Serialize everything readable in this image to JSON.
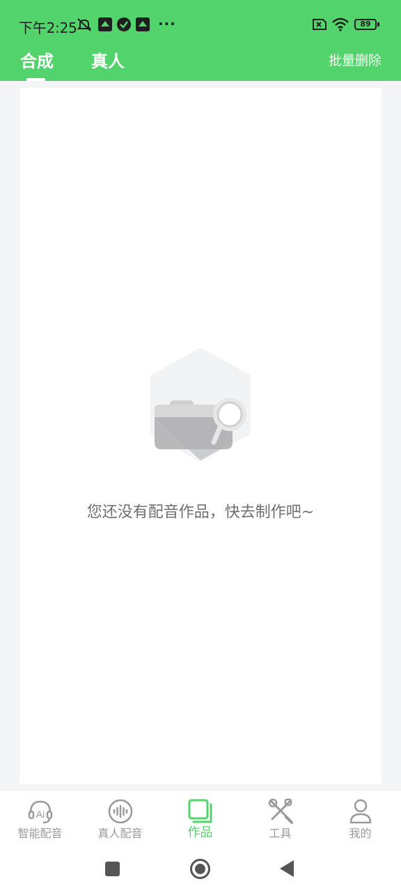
{
  "status_bar": {
    "time": "下午2:25",
    "battery": "89"
  },
  "tabs": [
    {
      "label": "合成",
      "active": true
    },
    {
      "label": "真人",
      "active": false
    }
  ],
  "header_action": "批量删除",
  "empty_state": {
    "message": "您还没有配音作品，快去制作吧~"
  },
  "bottom_nav": [
    {
      "label": "智能配音",
      "icon": "ai-headset-icon",
      "active": false
    },
    {
      "label": "真人配音",
      "icon": "soundwave-icon",
      "active": false
    },
    {
      "label": "作品",
      "icon": "works-icon",
      "active": true
    },
    {
      "label": "工具",
      "icon": "tools-icon",
      "active": false
    },
    {
      "label": "我的",
      "icon": "profile-icon",
      "active": false
    }
  ],
  "colors": {
    "accent": "#53d36c",
    "inactive": "#9a9a9a",
    "background": "#f4f5f7"
  }
}
